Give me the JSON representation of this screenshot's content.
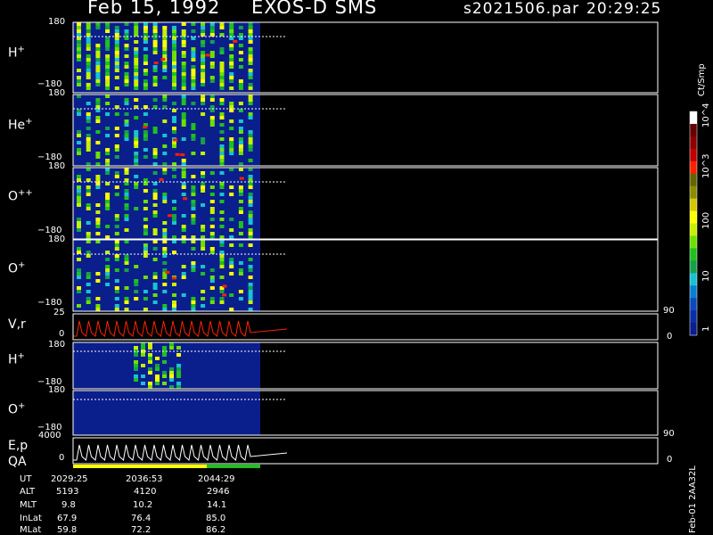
{
  "header": {
    "date": "Feb 15, 1992",
    "instrument": "EXOS-D SMS",
    "file": "s2021506.par",
    "time": "20:29:25"
  },
  "colors": {
    "background": "#000000",
    "fill": "#0a1e8c",
    "frame": "#ffffff",
    "colorbar": [
      "#0a1e8c",
      "#0a2fa5",
      "#0a4abf",
      "#0a7ed2",
      "#19c2d2",
      "#16a04a",
      "#20c020",
      "#6ee000",
      "#c8f000",
      "#ffff00",
      "#d2c800",
      "#8c8c00",
      "#646400",
      "#ff2000",
      "#c00000",
      "#8c0000",
      "#640000",
      "#ffffff"
    ]
  },
  "chart_data": {
    "type": "heatmap",
    "colorbar": {
      "label": "Ct/Smp",
      "ticks": [
        "1",
        "10",
        "100",
        "10^3",
        "10^4"
      ]
    },
    "panels": [
      {
        "id": "hp1",
        "label": "H",
        "sup": "+",
        "ymax": "180",
        "ymin": "−180"
      },
      {
        "id": "hep",
        "label": "He",
        "sup": "+",
        "ymax": "180",
        "ymin": "−180"
      },
      {
        "id": "opp",
        "label": "O",
        "sup": "++",
        "ymax": "180",
        "ymin": "−180"
      },
      {
        "id": "op1",
        "label": "O",
        "sup": "+",
        "ymax": "180",
        "ymin": "−180"
      },
      {
        "id": "vr",
        "label": "V,r",
        "ymax": "25",
        "ymin": "0",
        "right_top": "90",
        "right_bottom": "0"
      },
      {
        "id": "hp2",
        "label": "H",
        "sup": "+",
        "ymax": "180",
        "ymin": "−180"
      },
      {
        "id": "op2",
        "label": "O",
        "sup": "+",
        "ymax": "180",
        "ymin": "−180"
      },
      {
        "id": "ep",
        "label": "E,p",
        "ymax": "4000",
        "ymin": "0",
        "right_top": "90",
        "right_bottom": "0"
      }
    ],
    "qa_label": "QA"
  },
  "footer": {
    "rows": [
      {
        "name": "UT",
        "values": [
          "2029:25",
          "2036:53",
          "2044:29"
        ]
      },
      {
        "name": "ALT",
        "values": [
          "5193",
          "4120",
          "2946"
        ]
      },
      {
        "name": "MLT",
        "values": [
          "9.8",
          "10.2",
          "14.1"
        ]
      },
      {
        "name": "InLat",
        "values": [
          "67.9",
          "76.4",
          "85.0"
        ]
      },
      {
        "name": "MLat",
        "values": [
          "59.8",
          "72.2",
          "86.2"
        ]
      }
    ],
    "side_label": "Feb-01 2AA32L"
  }
}
